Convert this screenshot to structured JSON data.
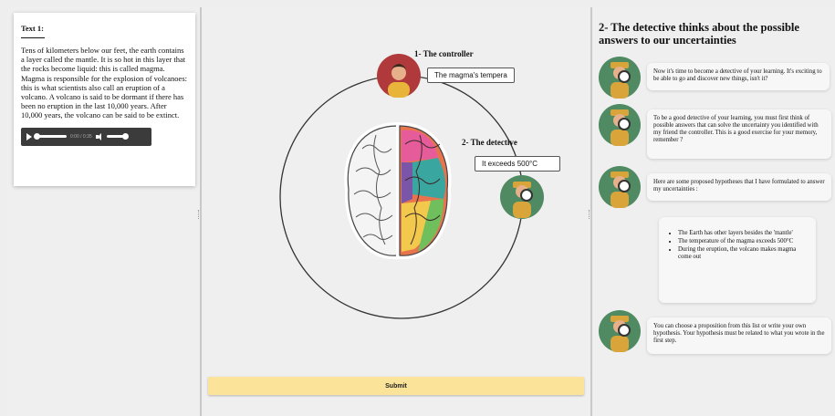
{
  "text_card": {
    "title": "Text 1:",
    "body": "Tens of kilometers below our feet, the earth contains a layer called the mantle. It is so hot in this layer that the rocks become liquid: this is called magma. Magma is responsible for the explosion of volcanoes: this is what scientists also call an eruption of a volcano. A volcano is said to be dormant if there has been no eruption in the last 10,000 years. After 10,000 years, the volcano can be said to be extinct.",
    "audio": {
      "time": "0:00 / 0:35"
    }
  },
  "diagram": {
    "controller_label": "1- The controller",
    "controller_speech": "The magma's tempera",
    "detective_label": "2- The detective",
    "detective_speech": "It exceeds 500°C"
  },
  "submit_label": "Submit",
  "right": {
    "title": "2- The detective thinks about the possible answers to our uncertainties",
    "messages": [
      "Now it's time to become a detective of your learning. It's exciting to be able to go and discover new things, isn't it?",
      "To be a good detective of your learning, you must first think of possible answers that can solve the uncertainty you identified with my friend the controller. This is a good exercise for your memory, remember ?",
      "Here are some proposed hypotheses that I have formulated to answer my uncertainties :",
      "You can choose a proposition from this list or write your own hypothesis. Your hypothesis must be related to what you wrote in the first step."
    ],
    "hypotheses": [
      "The Earth has other layers besides the 'mantle'",
      "The temperature of the magma exceeds 500°C",
      "During the eruption, the volcano makes magma come out"
    ]
  },
  "colors": {
    "controller_bg": "#b0393b",
    "detective_bg": "#4f8a63",
    "submit_bg": "#fbe39a"
  }
}
